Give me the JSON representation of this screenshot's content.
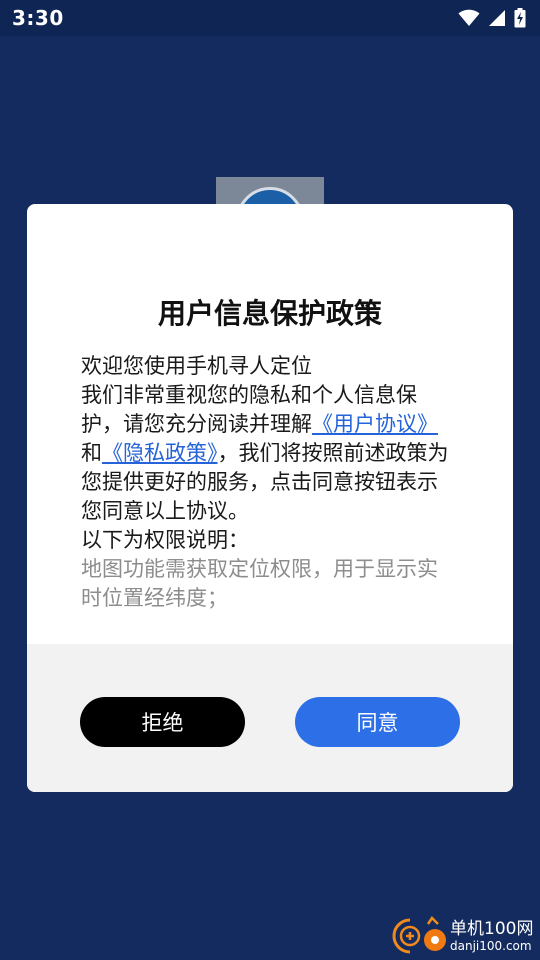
{
  "status_bar": {
    "time": "3:30",
    "icons": [
      "wifi-icon",
      "signal-icon",
      "battery-charging-icon"
    ]
  },
  "dialog": {
    "title": "用户信息保护政策",
    "intro": "欢迎您使用手机寻人定位",
    "body_prefix": "我们非常重视您的隐私和个人信息保护，请您充分阅读并理解",
    "user_agreement_link": "《用户协议》",
    "conjunction": "和",
    "privacy_policy_link": "《隐私政策》",
    "body_suffix": "，我们将按照前述政策为您提供更好的服务，点击同意按钮表示您同意以上协议。",
    "permissions_heading": "以下为权限说明：",
    "permissions_detail": "地图功能需获取定位权限，用于显示实时位置经纬度；",
    "reject_label": "拒绝",
    "agree_label": "同意"
  },
  "watermark": {
    "name": "单机100网",
    "url": "danji100.com"
  },
  "colors": {
    "background": "#132b5f",
    "link": "#2563d8",
    "agree_button": "#2c6fe6",
    "reject_button": "#000000",
    "muted_text": "#8d8d8d"
  }
}
